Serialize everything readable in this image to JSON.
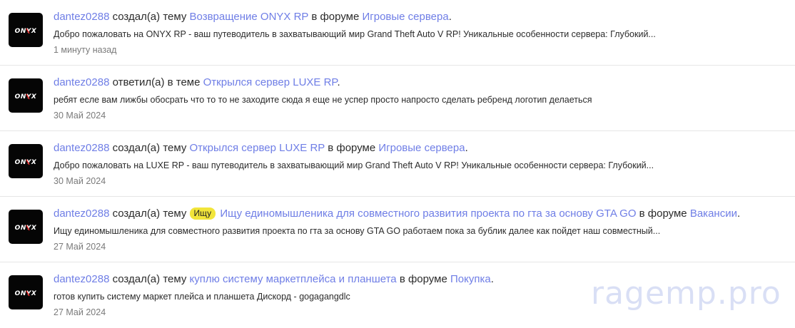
{
  "items": [
    {
      "user": "dantez0288",
      "action": "создал(а) тему",
      "prefix": "",
      "thread": "Возвращение ONYX RP",
      "forum_pre": "в форуме",
      "forum": "Игровые сервера",
      "end": ".",
      "snippet": "Добро пожаловать на ONYX RP - ваш путеводитель в захватывающий мир Grand Theft Auto V RP! Уникальные особенности сервера: Глубокий...",
      "time": "1 минуту назад"
    },
    {
      "user": "dantez0288",
      "action": "ответил(а) в теме",
      "prefix": "",
      "thread": "Открылся сервер LUXE RP",
      "forum_pre": "",
      "forum": "",
      "end": ".",
      "snippet": "ребят есле вам лижбы обосрать что то то не заходите сюда я еще не успер просто напросто сделать ребренд логотип делаеться",
      "time": "30 Май 2024"
    },
    {
      "user": "dantez0288",
      "action": "создал(а) тему",
      "prefix": "",
      "thread": "Открылся сервер LUXE RP",
      "forum_pre": "в форуме",
      "forum": "Игровые сервера",
      "end": ".",
      "snippet": "Добро пожаловать на LUXE RP - ваш путеводитель в захватывающий мир Grand Theft Auto V RP! Уникальные особенности сервера: Глубокий...",
      "time": "30 Май 2024"
    },
    {
      "user": "dantez0288",
      "action": "создал(а) тему",
      "prefix": "Ищу",
      "thread": "Ищу единомышленика для совместного развития проекта по гта за основу GTA GO",
      "forum_pre": "в форуме",
      "forum": "Вакансии",
      "end": ".",
      "snippet": "Ищу единомышленика для совместного развития проекта по гта за основу GTA GO работаем пока за бублик далее как пойдет наш совместный...",
      "time": "27 Май 2024"
    },
    {
      "user": "dantez0288",
      "action": "создал(а) тему",
      "prefix": "",
      "thread": "куплю систему маркетплейса и планшета",
      "forum_pre": "в форуме",
      "forum": "Покупка",
      "end": ".",
      "snippet": "готов купить систему маркет плейса и планшета Дискорд - gogagangdlc",
      "time": "27 Май 2024"
    }
  ],
  "avatar_text": "ONYX",
  "watermark": "ragemp.pro",
  "colors": {
    "link": "#6f7ee6",
    "prefix_bg": "#f2e53a",
    "muted": "#7a7a7a"
  }
}
